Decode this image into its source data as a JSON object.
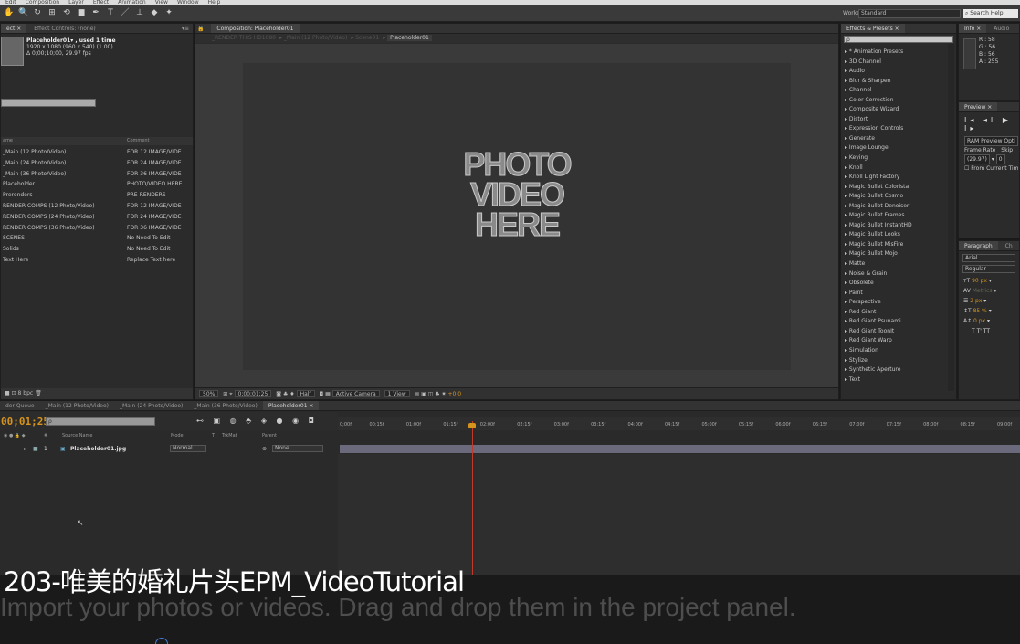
{
  "menubar": [
    "Edit",
    "Composition",
    "Layer",
    "Effect",
    "Animation",
    "View",
    "Window",
    "Help"
  ],
  "toolbar": {
    "tools": [
      "✋",
      "🔍",
      "↻",
      "⊞",
      "⟲",
      "■",
      "✒",
      "T",
      "／",
      "⊥",
      "◆",
      "✦"
    ],
    "workspace_label": "Workspace:",
    "workspace_value": "Standard",
    "search_help": "Search Help"
  },
  "project": {
    "tabs": [
      "ect ×",
      "Effect Controls: (none)"
    ],
    "item_name": "Placeholder01▾ , used 1 time",
    "item_dims": "1920 x 1080 (960 x 540) (1.00)",
    "item_duration": "Δ 0;00;10;00, 29.97 fps",
    "col_name": "ame",
    "col_comment": "Comment",
    "rows": [
      {
        "name": "_Main (12 Photo/Video)",
        "comment": "FOR 12 IMAGE/VIDE"
      },
      {
        "name": "_Main (24 Photo/Video)",
        "comment": "FOR 24 IMAGE/VIDE"
      },
      {
        "name": "_Main (36 Photo/Video)",
        "comment": "FOR 36 IMAGE/VIDE"
      },
      {
        "name": "Placeholder",
        "comment": "PHOTO/VIDEO HERE"
      },
      {
        "name": "Prerenders",
        "comment": "PRE-RENDERS"
      },
      {
        "name": "RENDER COMPS (12 Photo/Video)",
        "comment": "FOR 12 IMAGE/VIDE"
      },
      {
        "name": "RENDER COMPS (24 Photo/Video)",
        "comment": "FOR 24 IMAGE/VIDE"
      },
      {
        "name": "RENDER COMPS (36 Photo/Video)",
        "comment": "FOR 36 IMAGE/VIDE"
      },
      {
        "name": "SCENES",
        "comment": "No Need To Edit"
      },
      {
        "name": "Solids",
        "comment": "No Need To Edit"
      },
      {
        "name": "Text Here",
        "comment": "Replace Text here"
      }
    ],
    "bpc": "8 bpc"
  },
  "comp": {
    "tab": "Composition: Placeholder01",
    "crumbs": [
      "_RENDER THIS HD1080",
      "_Main (12 Photo/Video)",
      "Scene01"
    ],
    "crumb_current": "Placeholder01",
    "frame_lines": [
      "PHOTO",
      "VIDEO",
      "HERE"
    ],
    "zoom": "50%",
    "timecode": "0;00;01;25",
    "resolution": "Half",
    "camera": "Active Camera",
    "view": "1 View",
    "exposure": "+0.0"
  },
  "effects": {
    "tab": "Effects & Presets ×",
    "search_placeholder": "ρ",
    "items": [
      "▸ * Animation Presets",
      "▸ 3D Channel",
      "▸ Audio",
      "▸ Blur & Sharpen",
      "▸ Channel",
      "▸ Color Correction",
      "▸ Composite Wizard",
      "▸ Distort",
      "▸ Expression Controls",
      "▸ Generate",
      "▸ Image Lounge",
      "▸ Keying",
      "▸ Knoll",
      "▸ Knoll Light Factory",
      "▸ Magic Bullet Colorista",
      "▸ Magic Bullet Cosmo",
      "▸ Magic Bullet Denoiser",
      "▸ Magic Bullet Frames",
      "▸ Magic Bullet InstantHD",
      "▸ Magic Bullet Looks",
      "▸ Magic Bullet MisFire",
      "▸ Magic Bullet Mojo",
      "▸ Matte",
      "▸ Noise & Grain",
      "▸ Obsolete",
      "▸ Paint",
      "▸ Perspective",
      "▸ Red Giant",
      "▸ Red Giant Psunami",
      "▸ Red Giant ToonIt",
      "▸ Red Giant Warp",
      "▸ Simulation",
      "▸ Stylize",
      "▸ Synthetic Aperture",
      "▸ Text"
    ]
  },
  "info": {
    "tabs": [
      "Info ×",
      "Audio"
    ],
    "values": [
      "R : 58",
      "G : 56",
      "B : 56",
      "A : 255"
    ]
  },
  "preview": {
    "tab": "Preview ×",
    "buttons": "I◂ ◂I ▶ I▸",
    "ram": "RAM Preview Opti",
    "frame_rate_label": "Frame Rate",
    "skip_label": "Skip",
    "frame_rate_value": "(29.97)",
    "skip_value": "0",
    "from_current": "From Current Tim"
  },
  "paragraph": {
    "tabs": [
      "Paragraph",
      "Ch"
    ],
    "font": "Arial",
    "style": "Regular",
    "size": "90 px",
    "leading": "Metrics",
    "stroke": "2 px",
    "vscale": "85 %",
    "baseline": "0 px",
    "caps": "T  T'  TT"
  },
  "timeline": {
    "tabs": [
      "der Queue",
      "_Main (12 Photo/Video)",
      "_Main (24 Photo/Video)",
      "_Main (36 Photo/Video)",
      "Placeholder01 ×"
    ],
    "timecode": "00;01;25",
    "search_placeholder": "ρ",
    "cols": {
      "num": "#",
      "source": "Source Name",
      "mode": "Mode",
      "t": "T",
      "trkmat": "TrkMat",
      "parent": "Parent"
    },
    "layer": {
      "num": "1",
      "name": "Placeholder01.jpg",
      "mode": "Normal",
      "parent": "None"
    },
    "ticks": [
      "0;00f",
      "00:15f",
      "01:00f",
      "01:15f",
      "02:00f",
      "02:15f",
      "03:00f",
      "03:15f",
      "04:00f",
      "04:15f",
      "05:00f",
      "05:15f",
      "06:00f",
      "06:15f",
      "07:00f",
      "07:15f",
      "08:00f",
      "08:15f",
      "09:00f"
    ]
  },
  "subtitles": {
    "line1": "203-唯美的婚礼片头EPM_VideoTutorial",
    "line2": "Import your photos or videos. Drag and drop them in the project panel."
  }
}
